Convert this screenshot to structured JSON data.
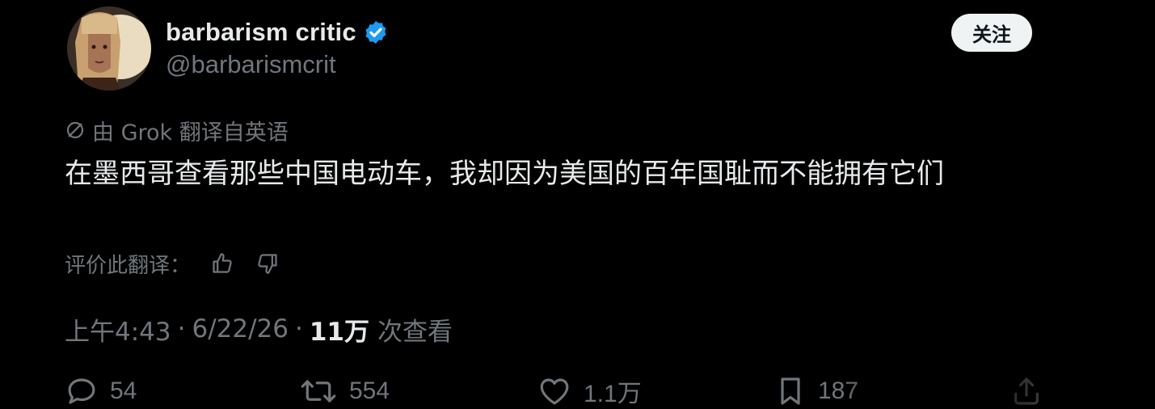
{
  "author": {
    "display_name": "barbarism critic",
    "handle": "@barbarismcrit",
    "verified": true,
    "verified_color": "#1d9bf0"
  },
  "follow_button": {
    "label": "关注"
  },
  "translation": {
    "note": "由 Grok 翻译自英语",
    "icon": "no-entry-icon"
  },
  "tweet": {
    "text": "在墨西哥查看那些中国电动车，我却因为美国的百年国耻而不能拥有它们"
  },
  "rate": {
    "label": "评价此翻译：",
    "thumbs_up_icon": "thumbs-up-icon",
    "thumbs_down_icon": "thumbs-down-icon"
  },
  "meta": {
    "time": "上午4:43",
    "date": "6/22/26",
    "separator": "·",
    "views_count": "11万",
    "views_label": "次查看"
  },
  "actions": {
    "reply_count": "54",
    "retweet_count": "554",
    "like_count": "1.1万",
    "bookmark_count": "187",
    "icons": [
      "reply-icon",
      "retweet-icon",
      "like-icon",
      "bookmark-icon",
      "share-icon"
    ]
  },
  "colors": {
    "background": "#000000",
    "primary_text": "#e7e9ea",
    "secondary_text": "#71767b",
    "button_bg": "#eff3f4"
  }
}
